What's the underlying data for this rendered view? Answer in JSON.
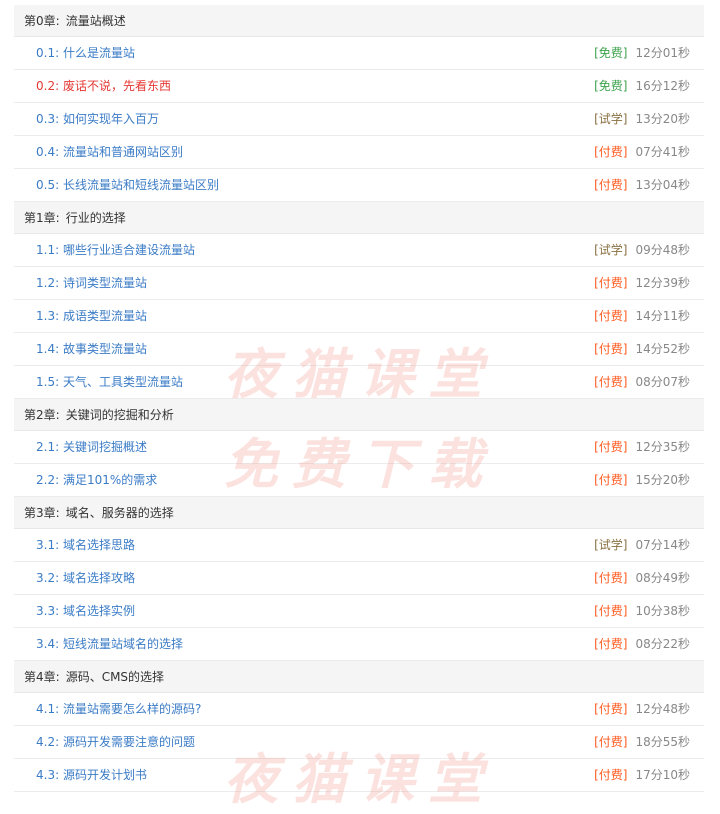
{
  "watermark": {
    "line1": "夜猫课堂",
    "line2": "免费下载"
  },
  "chapters": [
    {
      "label": "第0章:",
      "title": "流量站概述",
      "lessons": [
        {
          "num": "0.1:",
          "title": "什么是流量站",
          "tag": "[免费]",
          "tag_type": "free",
          "duration": "12分01秒"
        },
        {
          "num": "0.2:",
          "title": "废话不说，先看东西",
          "tag": "[免费]",
          "tag_type": "free",
          "duration": "16分12秒",
          "active": true
        },
        {
          "num": "0.3:",
          "title": "如何实现年入百万",
          "tag": "[试学]",
          "tag_type": "trial",
          "duration": "13分20秒"
        },
        {
          "num": "0.4:",
          "title": "流量站和普通网站区别",
          "tag": "[付费]",
          "tag_type": "paid",
          "duration": "07分41秒"
        },
        {
          "num": "0.5:",
          "title": "长线流量站和短线流量站区别",
          "tag": "[付费]",
          "tag_type": "paid",
          "duration": "13分04秒"
        }
      ]
    },
    {
      "label": "第1章:",
      "title": "行业的选择",
      "lessons": [
        {
          "num": "1.1:",
          "title": "哪些行业适合建设流量站",
          "tag": "[试学]",
          "tag_type": "trial",
          "duration": "09分48秒"
        },
        {
          "num": "1.2:",
          "title": "诗词类型流量站",
          "tag": "[付费]",
          "tag_type": "paid",
          "duration": "12分39秒"
        },
        {
          "num": "1.3:",
          "title": "成语类型流量站",
          "tag": "[付费]",
          "tag_type": "paid",
          "duration": "14分11秒"
        },
        {
          "num": "1.4:",
          "title": "故事类型流量站",
          "tag": "[付费]",
          "tag_type": "paid",
          "duration": "14分52秒"
        },
        {
          "num": "1.5:",
          "title": "天气、工具类型流量站",
          "tag": "[付费]",
          "tag_type": "paid",
          "duration": "08分07秒"
        }
      ]
    },
    {
      "label": "第2章:",
      "title": "关键词的挖掘和分析",
      "lessons": [
        {
          "num": "2.1:",
          "title": "关键词挖掘概述",
          "tag": "[付费]",
          "tag_type": "paid",
          "duration": "12分35秒"
        },
        {
          "num": "2.2:",
          "title": "满足101%的需求",
          "tag": "[付费]",
          "tag_type": "paid",
          "duration": "15分20秒"
        }
      ]
    },
    {
      "label": "第3章:",
      "title": "域名、服务器的选择",
      "lessons": [
        {
          "num": "3.1:",
          "title": "域名选择思路",
          "tag": "[试学]",
          "tag_type": "trial",
          "duration": "07分14秒"
        },
        {
          "num": "3.2:",
          "title": "域名选择攻略",
          "tag": "[付费]",
          "tag_type": "paid",
          "duration": "08分49秒"
        },
        {
          "num": "3.3:",
          "title": "域名选择实例",
          "tag": "[付费]",
          "tag_type": "paid",
          "duration": "10分38秒"
        },
        {
          "num": "3.4:",
          "title": "短线流量站域名的选择",
          "tag": "[付费]",
          "tag_type": "paid",
          "duration": "08分22秒"
        }
      ]
    },
    {
      "label": "第4章:",
      "title": "源码、CMS的选择",
      "lessons": [
        {
          "num": "4.1:",
          "title": "流量站需要怎么样的源码?",
          "tag": "[付费]",
          "tag_type": "paid",
          "duration": "12分48秒"
        },
        {
          "num": "4.2:",
          "title": "源码开发需要注意的问题",
          "tag": "[付费]",
          "tag_type": "paid",
          "duration": "18分55秒"
        },
        {
          "num": "4.3:",
          "title": "源码开发计划书",
          "tag": "[付费]",
          "tag_type": "paid",
          "duration": "17分10秒"
        }
      ]
    }
  ]
}
